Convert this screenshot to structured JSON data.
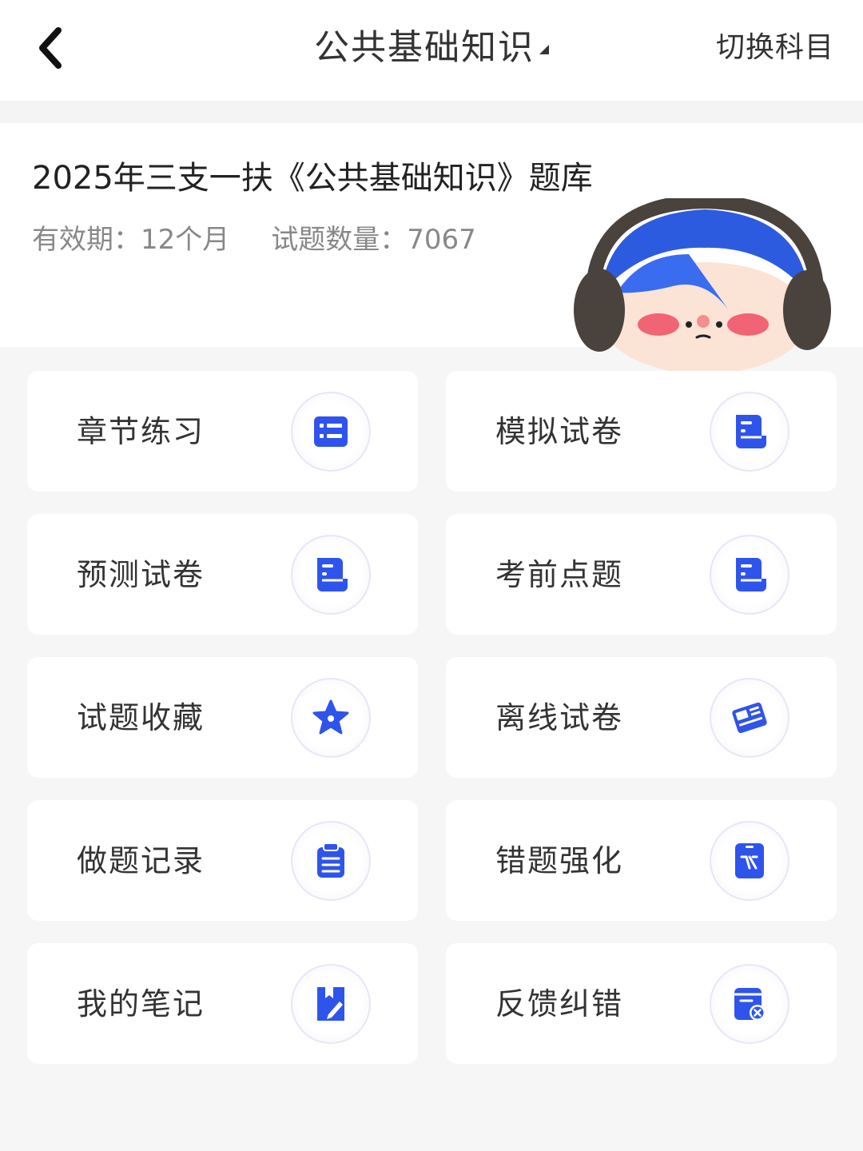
{
  "header": {
    "title": "公共基础知识",
    "switch_label": "切换科目"
  },
  "bank": {
    "title": "2025年三支一扶《公共基础知识》题库",
    "validity_label": "有效期：",
    "validity_value": "12个月",
    "count_label": "试题数量：",
    "count_value": "7067"
  },
  "colors": {
    "accent": "#2f54eb",
    "background": "#f6f6f6",
    "card": "#ffffff"
  },
  "menu": [
    {
      "label": "章节练习",
      "icon": "list-icon"
    },
    {
      "label": "模拟试卷",
      "icon": "paper-icon"
    },
    {
      "label": "预测试卷",
      "icon": "paper-icon"
    },
    {
      "label": "考前点题",
      "icon": "paper-icon"
    },
    {
      "label": "试题收藏",
      "icon": "star-icon"
    },
    {
      "label": "离线试卷",
      "icon": "book-icon"
    },
    {
      "label": "做题记录",
      "icon": "clipboard-icon"
    },
    {
      "label": "错题强化",
      "icon": "tablet-icon"
    },
    {
      "label": "我的笔记",
      "icon": "note-icon"
    },
    {
      "label": "反馈纠错",
      "icon": "feedback-icon"
    }
  ]
}
